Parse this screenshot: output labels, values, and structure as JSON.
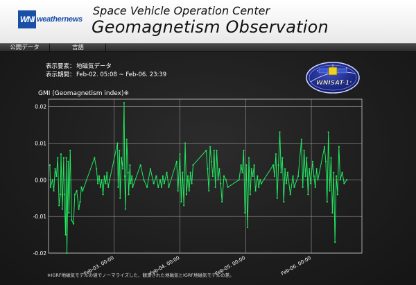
{
  "header": {
    "brand_mark": "WNI",
    "brand_name": "weathernews",
    "org_name": "Space Vehicle Operation Center",
    "page_title": "Geomagnetism Observation"
  },
  "menu": {
    "items": [
      {
        "label": "公開データ"
      },
      {
        "label": "言語"
      }
    ]
  },
  "info": {
    "element_label": "表示要素：",
    "element_value": "地磁気データ",
    "period_label": "表示期間：",
    "period_value": "Feb-02. 05:08 ~ Feb-06. 23:39"
  },
  "badge": {
    "label": "WNISAT-1"
  },
  "colors": {
    "line": "#22e860",
    "grid": "#9a9a9a",
    "frame": "#cfcfcf"
  },
  "footnote": "※IGRF地磁気モデルの値でノーマライズした、観測された地磁気とIGRF地磁気モデルの差。",
  "chart_data": {
    "type": "line",
    "title": "GMI (Geomagnetism index)※",
    "xlabel": "",
    "ylabel": "",
    "ylim": [
      -0.02,
      0.022
    ],
    "xlim": [
      0,
      4.77
    ],
    "x_tick_values": [
      1,
      2,
      3,
      4
    ],
    "x_tick_labels": [
      "Feb-03. 00:00",
      "Feb-04. 00:00",
      "Feb-05. 00:00",
      "Feb-06. 00:00"
    ],
    "y_tick_values": [
      0.02,
      0.01,
      0.0,
      -0.01,
      -0.02
    ],
    "y_tick_labels": [
      "0.02",
      "0.01",
      "0.00",
      "-0.01",
      "-0.02"
    ],
    "grid": true,
    "series": [
      {
        "name": "",
        "points": [
          [
            0.02,
            0.004
          ],
          [
            0.03,
            -0.002
          ],
          [
            0.06,
            0.0
          ],
          [
            0.08,
            -0.003
          ],
          [
            0.1,
            0.003
          ],
          [
            0.12,
            0.001
          ],
          [
            0.14,
            0.006
          ],
          [
            0.16,
            -0.007
          ],
          [
            0.18,
            -0.004
          ],
          [
            0.19,
            0.007
          ],
          [
            0.21,
            -0.008
          ],
          [
            0.23,
            0.006
          ],
          [
            0.24,
            -0.004
          ],
          [
            0.26,
            -0.015
          ],
          [
            0.27,
            0.006
          ],
          [
            0.28,
            -0.02
          ],
          [
            0.3,
            0.005
          ],
          [
            0.31,
            -0.009
          ],
          [
            0.33,
            0.008
          ],
          [
            0.35,
            -0.011
          ],
          [
            0.38,
            -0.012
          ],
          [
            0.4,
            -0.004
          ],
          [
            0.43,
            -0.003
          ],
          [
            0.46,
            -0.008
          ],
          [
            0.48,
            -0.006
          ],
          [
            0.5,
            -0.002
          ],
          [
            0.52,
            -0.003
          ],
          [
            0.7,
            0.006
          ],
          [
            0.73,
            0.003
          ],
          [
            0.75,
            -0.001
          ],
          [
            0.77,
            0.001
          ],
          [
            0.79,
            -0.002
          ],
          [
            0.81,
            0.0
          ],
          [
            0.83,
            -0.004
          ],
          [
            0.85,
            0.001
          ],
          [
            0.87,
            -0.001
          ],
          [
            0.89,
            0.002
          ],
          [
            0.91,
            -0.002
          ],
          [
            0.93,
            0.0
          ],
          [
            1.05,
            0.01
          ],
          [
            1.06,
            -0.002
          ],
          [
            1.08,
            0.008
          ],
          [
            1.09,
            -0.005
          ],
          [
            1.11,
            0.006
          ],
          [
            1.13,
            0.003
          ],
          [
            1.15,
            0.021
          ],
          [
            1.16,
            0.001
          ],
          [
            1.17,
            -0.008
          ],
          [
            1.19,
            0.011
          ],
          [
            1.21,
            0.002
          ],
          [
            1.22,
            -0.004
          ],
          [
            1.24,
            0.004
          ],
          [
            1.25,
            -0.001
          ],
          [
            1.27,
            0.001
          ],
          [
            1.28,
            -0.002
          ],
          [
            1.4,
            0.004
          ],
          [
            1.45,
            0.0
          ],
          [
            1.5,
            -0.002
          ],
          [
            1.55,
            0.003
          ],
          [
            1.6,
            -0.001
          ],
          [
            1.64,
            0.001
          ],
          [
            1.67,
            -0.002
          ],
          [
            1.7,
            0.0
          ],
          [
            1.72,
            -0.002
          ],
          [
            1.74,
            0.001
          ],
          [
            1.76,
            -0.001
          ],
          [
            1.8,
            0.002
          ],
          [
            1.83,
            -0.002
          ],
          [
            1.95,
            0.005
          ],
          [
            1.97,
            -0.003
          ],
          [
            2.0,
            0.007
          ],
          [
            2.02,
            -0.006
          ],
          [
            2.04,
            0.002
          ],
          [
            2.06,
            -0.007
          ],
          [
            2.08,
            0.01
          ],
          [
            2.1,
            -0.004
          ],
          [
            2.12,
            0.001
          ],
          [
            2.14,
            -0.003
          ],
          [
            2.16,
            0.002
          ],
          [
            2.18,
            -0.001
          ],
          [
            2.2,
            0.004
          ],
          [
            2.4,
            0.008
          ],
          [
            2.42,
            0.003
          ],
          [
            2.44,
            -0.003
          ],
          [
            2.46,
            0.009
          ],
          [
            2.48,
            0.005
          ],
          [
            2.5,
            0.001
          ],
          [
            2.52,
            0.008
          ],
          [
            2.54,
            -0.002
          ],
          [
            2.56,
            0.008
          ],
          [
            2.58,
            0.0
          ],
          [
            2.6,
            0.003
          ],
          [
            2.62,
            -0.001
          ],
          [
            2.64,
            -0.006
          ],
          [
            2.67,
            0.001
          ],
          [
            2.7,
            0.0
          ],
          [
            2.73,
            -0.002
          ],
          [
            2.9,
            0.0
          ],
          [
            2.93,
            0.004
          ],
          [
            2.95,
            0.002
          ],
          [
            2.97,
            0.008
          ],
          [
            2.99,
            -0.009
          ],
          [
            3.01,
            0.004
          ],
          [
            3.03,
            -0.013
          ],
          [
            3.05,
            0.006
          ],
          [
            3.07,
            -0.004
          ],
          [
            3.09,
            0.003
          ],
          [
            3.11,
            0.001
          ],
          [
            3.13,
            0.004
          ],
          [
            3.15,
            -0.003
          ],
          [
            3.18,
            0.001
          ],
          [
            3.2,
            -0.002
          ],
          [
            3.22,
            0.0
          ],
          [
            3.24,
            -0.001
          ],
          [
            3.42,
            0.004
          ],
          [
            3.44,
            0.001
          ],
          [
            3.46,
            0.007
          ],
          [
            3.48,
            -0.005
          ],
          [
            3.5,
            0.004
          ],
          [
            3.52,
            0.013
          ],
          [
            3.54,
            0.002
          ],
          [
            3.56,
            0.006
          ],
          [
            3.58,
            -0.006
          ],
          [
            3.6,
            0.003
          ],
          [
            3.62,
            -0.001
          ],
          [
            3.64,
            0.002
          ],
          [
            3.68,
            -0.004
          ],
          [
            3.72,
            0.001
          ],
          [
            3.74,
            -0.002
          ],
          [
            3.8,
            0.001
          ],
          [
            3.85,
            0.011
          ],
          [
            3.87,
            -0.002
          ],
          [
            3.89,
            0.008
          ],
          [
            3.91,
            0.001
          ],
          [
            3.93,
            0.006
          ],
          [
            3.95,
            -0.004
          ],
          [
            3.97,
            0.003
          ],
          [
            3.99,
            -0.001
          ],
          [
            4.02,
            0.005
          ],
          [
            4.04,
            0.001
          ],
          [
            4.06,
            -0.002
          ],
          [
            4.08,
            0.003
          ],
          [
            4.1,
            0.0
          ],
          [
            4.2,
            0.009
          ],
          [
            4.22,
            0.005
          ],
          [
            4.24,
            -0.006
          ],
          [
            4.26,
            0.013
          ],
          [
            4.28,
            -0.003
          ],
          [
            4.3,
            0.006
          ],
          [
            4.32,
            -0.009
          ],
          [
            4.34,
            0.002
          ],
          [
            4.36,
            -0.017
          ],
          [
            4.38,
            0.001
          ],
          [
            4.4,
            -0.004
          ],
          [
            4.42,
            0.009
          ],
          [
            4.44,
            0.0
          ],
          [
            4.47,
            0.002
          ],
          [
            4.5,
            -0.001
          ],
          [
            4.54,
            0.0
          ]
        ]
      }
    ]
  }
}
